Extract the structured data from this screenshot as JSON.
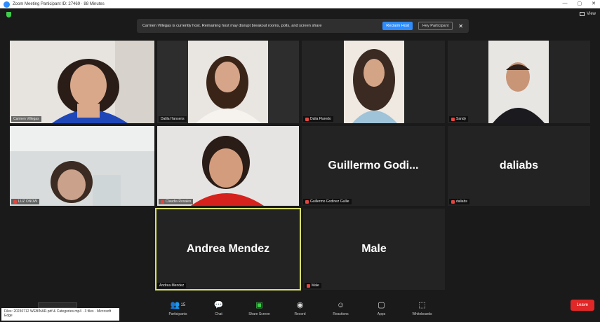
{
  "window": {
    "title": "Zoom Meeting Participant ID: 27469 · 88 Minutes",
    "controls": [
      "—",
      "▢",
      "✕"
    ]
  },
  "view_button": {
    "label": "View"
  },
  "banner": {
    "message": "Carmen Villegas is currently host. Remaining host may disrupt breakout rooms, polls, and screen share",
    "primary_label": "Reclaim Host",
    "secondary_label": "Hey Participant",
    "close": "✕"
  },
  "tiles": [
    {
      "name": "Carmen Villegas",
      "muted": false
    },
    {
      "name": "Dalila Hansens",
      "muted": false
    },
    {
      "name": "Dalia Flaredo",
      "muted": true
    },
    {
      "name": "Sandy",
      "muted": true
    },
    {
      "name": "LUZ ONOW",
      "muted": true
    },
    {
      "name": "Claudia Rosales",
      "muted": true
    },
    {
      "name": "Guillermo Godi...",
      "tag": "Guillermo Godinez Gullie",
      "muted": true
    },
    {
      "name": "daliabs",
      "tag": "daliabs",
      "muted": true
    },
    {
      "name": "Andrea Mendez",
      "tag": "Andrea Mendez",
      "muted": false
    },
    {
      "name": "Male",
      "tag": "Male",
      "muted": true
    }
  ],
  "toolbar": {
    "items": [
      {
        "label": "Participants",
        "icon": "participants-icon"
      },
      {
        "label": "Chat",
        "icon": "chat-icon"
      },
      {
        "label": "Share Screen",
        "icon": "share-screen-icon"
      },
      {
        "label": "Record",
        "icon": "record-icon"
      },
      {
        "label": "Reactions",
        "icon": "reactions-icon"
      },
      {
        "label": "Apps",
        "icon": "apps-icon"
      },
      {
        "label": "Whiteboards",
        "icon": "whiteboards-icon"
      }
    ],
    "participant_count": "15",
    "leave_label": "Leave"
  },
  "notice": {
    "text": "Files: 20230712 WEBINAR.pdf & Categories.mp4 · 3 files · Microsoft Edge"
  },
  "colors": {
    "accent": "#2d8cff",
    "leave": "#e02828",
    "active_speaker": "#d8e06b",
    "share_green": "#3ecf4a"
  }
}
